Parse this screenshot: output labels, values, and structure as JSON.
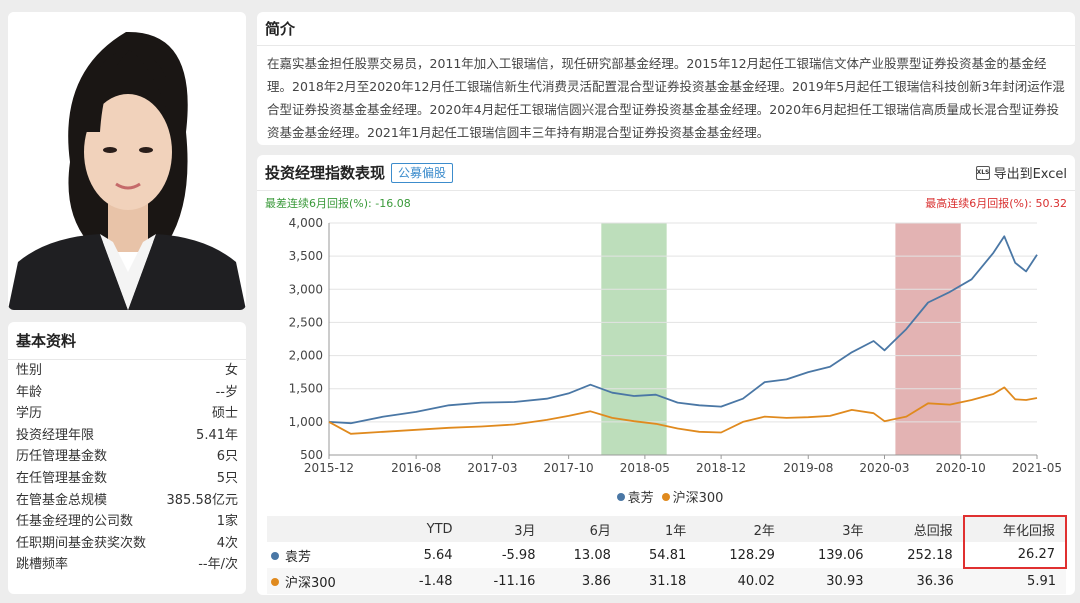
{
  "basic": {
    "title": "基本资料",
    "rows": [
      {
        "k": "性别",
        "v": "女"
      },
      {
        "k": "年龄",
        "v": "--岁"
      },
      {
        "k": "学历",
        "v": "硕士"
      },
      {
        "k": "投资经理年限",
        "v": "5.41年"
      },
      {
        "k": "历任管理基金数",
        "v": "6只"
      },
      {
        "k": "在任管理基金数",
        "v": "5只"
      },
      {
        "k": "在管基金总规模",
        "v": "385.58亿元"
      },
      {
        "k": "任基金经理的公司数",
        "v": "1家"
      },
      {
        "k": "任职期间基金获奖次数",
        "v": "4次"
      },
      {
        "k": "跳槽频率",
        "v": "--年/次"
      }
    ]
  },
  "intro": {
    "title": "简介",
    "text": "在嘉实基金担任股票交易员，2011年加入工银瑞信，现任研究部基金经理。2015年12月起任工银瑞信文体产业股票型证券投资基金的基金经理。2018年2月至2020年12月任工银瑞信新生代消费灵活配置混合型证券投资基金基金经理。2019年5月起任工银瑞信科技创新3年封闭运作混合型证券投资基金基金经理。2020年4月起任工银瑞信圆兴混合型证券投资基金基金经理。2020年6月起担任工银瑞信高质量成长混合型证券投资基金基金经理。2021年1月起任工银瑞信圆丰三年持有期混合型证券投资基金基金经理。"
  },
  "chart_panel": {
    "title": "投资经理指数表现",
    "tag": "公募偏股",
    "export_label": "导出到Excel",
    "export_icon": "xls-icon",
    "worst_label": "最差连续6月回报(%): -16.08",
    "best_label": "最高连续6月回报(%): 50.32"
  },
  "chart_data": {
    "type": "line",
    "x_ticks": [
      "2015-12",
      "2016-08",
      "2017-03",
      "2017-10",
      "2018-05",
      "2018-12",
      "2019-08",
      "2020-03",
      "2020-10",
      "2021-05"
    ],
    "y_ticks": [
      "500",
      "1,000",
      "1,500",
      "2,000",
      "2,500",
      "3,000",
      "3,500",
      "4,000"
    ],
    "ylim": [
      500,
      4000
    ],
    "grid": true,
    "legend_position": "bottom",
    "shaded_periods": [
      {
        "from": "2018-01",
        "to": "2018-07",
        "color": "#a7d3a4"
      },
      {
        "from": "2020-04",
        "to": "2020-10",
        "color": "#d99a9a"
      }
    ],
    "series": [
      {
        "name": "袁芳",
        "color": "#4a77a5",
        "x": [
          "2015-12",
          "2016-02",
          "2016-05",
          "2016-08",
          "2016-11",
          "2017-02",
          "2017-05",
          "2017-08",
          "2017-10",
          "2017-12",
          "2018-02",
          "2018-04",
          "2018-06",
          "2018-08",
          "2018-10",
          "2018-12",
          "2019-02",
          "2019-04",
          "2019-06",
          "2019-08",
          "2019-10",
          "2019-12",
          "2020-02",
          "2020-03",
          "2020-05",
          "2020-07",
          "2020-09",
          "2020-11",
          "2021-01",
          "2021-02",
          "2021-03",
          "2021-04",
          "2021-05"
        ],
        "values": [
          1000,
          980,
          1080,
          1150,
          1250,
          1290,
          1300,
          1350,
          1430,
          1560,
          1440,
          1390,
          1410,
          1290,
          1250,
          1230,
          1350,
          1600,
          1640,
          1750,
          1830,
          2050,
          2220,
          2080,
          2400,
          2800,
          2960,
          3150,
          3550,
          3800,
          3400,
          3270,
          3520
        ]
      },
      {
        "name": "沪深300",
        "color": "#e08a1e",
        "x": [
          "2015-12",
          "2016-02",
          "2016-05",
          "2016-08",
          "2016-11",
          "2017-02",
          "2017-05",
          "2017-08",
          "2017-10",
          "2017-12",
          "2018-02",
          "2018-04",
          "2018-06",
          "2018-08",
          "2018-10",
          "2018-12",
          "2019-02",
          "2019-04",
          "2019-06",
          "2019-08",
          "2019-10",
          "2019-12",
          "2020-02",
          "2020-03",
          "2020-05",
          "2020-07",
          "2020-09",
          "2020-11",
          "2021-01",
          "2021-02",
          "2021-03",
          "2021-04",
          "2021-05"
        ],
        "values": [
          1000,
          820,
          850,
          880,
          910,
          930,
          960,
          1030,
          1090,
          1160,
          1060,
          1010,
          970,
          900,
          850,
          840,
          1000,
          1080,
          1060,
          1070,
          1090,
          1180,
          1130,
          1010,
          1080,
          1280,
          1260,
          1330,
          1420,
          1520,
          1340,
          1330,
          1360
        ]
      }
    ]
  },
  "table": {
    "headers": [
      "",
      "YTD",
      "3月",
      "6月",
      "1年",
      "2年",
      "3年",
      "总回报",
      "年化回报"
    ],
    "rows": [
      {
        "name": "袁芳",
        "color": "#4a77a5",
        "values": [
          "5.64",
          "-5.98",
          "13.08",
          "54.81",
          "128.29",
          "139.06",
          "252.18",
          "26.27"
        ]
      },
      {
        "name": "沪深300",
        "color": "#e08a1e",
        "values": [
          "-1.48",
          "-11.16",
          "3.86",
          "31.18",
          "40.02",
          "30.93",
          "36.36",
          "5.91"
        ]
      }
    ]
  }
}
